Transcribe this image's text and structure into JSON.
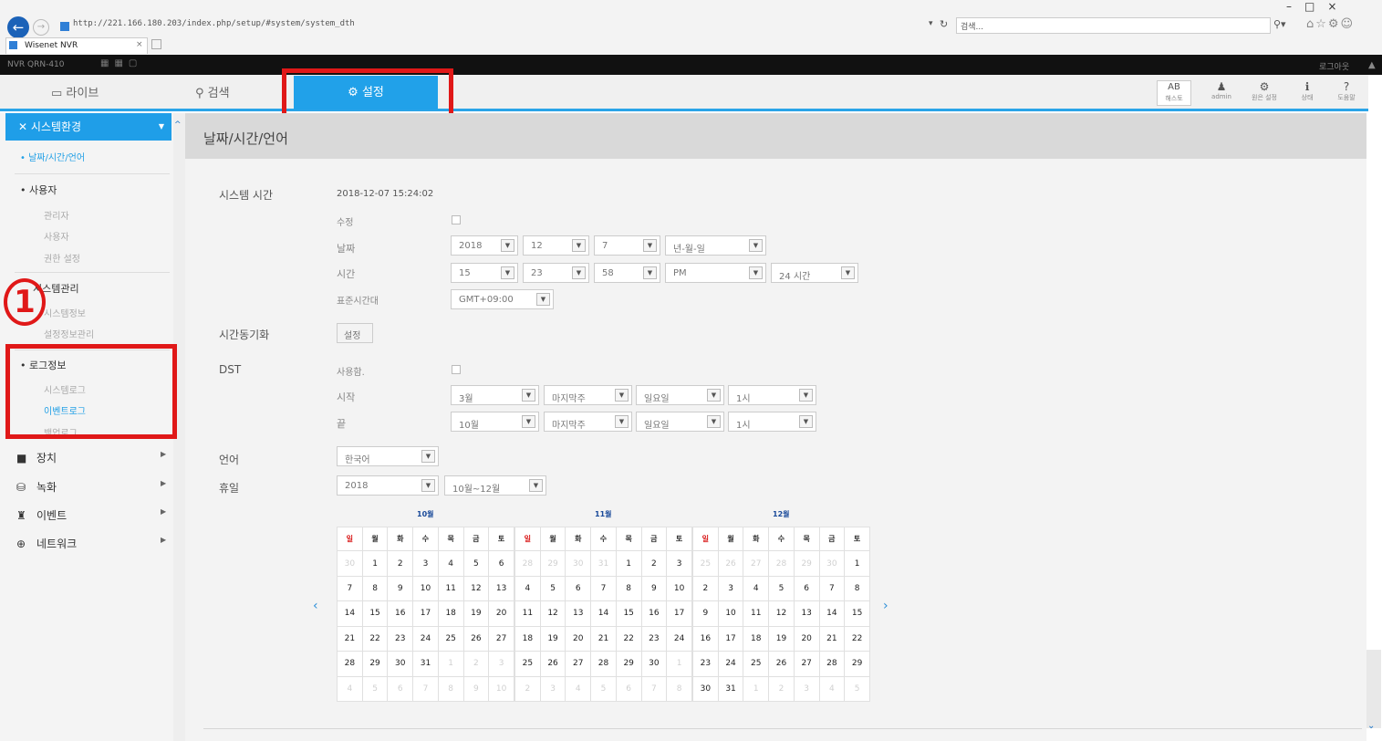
{
  "browser": {
    "address": "http://221.166.180.203/index.php/setup/#system/system_dth",
    "search_placeholder": "검색...",
    "tab_title": "Wisenet NVR",
    "tab_close": "×"
  },
  "topbar": {
    "model": "NVR QRN-410",
    "logout": "로그아웃"
  },
  "nav": {
    "live": "라이브",
    "search": "검색",
    "setup": "설정"
  },
  "toolbar": [
    {
      "name": "ab",
      "glyph": "AB",
      "label": "해스토"
    },
    {
      "name": "admin",
      "glyph": "👤",
      "label": "admin"
    },
    {
      "name": "shutdown",
      "glyph": "⚙",
      "label": "원은 설정"
    },
    {
      "name": "info",
      "glyph": "ℹ",
      "label": "상태"
    },
    {
      "name": "help",
      "glyph": "?",
      "label": "도움말"
    }
  ],
  "sidebar": {
    "header": "시스템환경",
    "sel_item": "날짜/시간/언어",
    "user": "사용자",
    "admin": "관리자",
    "user_sub": "사용자",
    "perm": "권한 설정",
    "sysmgmt": "시스템관리",
    "sysinfo": "시스템정보",
    "cfgmgmt": "설정정보관리",
    "log": "로그정보",
    "syslog": "시스템로그",
    "eventlog": "이벤트로그",
    "backuplog": "백업로그",
    "device": "장치",
    "record": "녹화",
    "event": "이벤트",
    "network": "네트워크",
    "circle": "1"
  },
  "content": {
    "title": "날짜/시간/언어",
    "systime_label": "시스템 시간",
    "systime_value": "2018-12-07 15:24:02",
    "edit_label": "수정",
    "date_label": "날짜",
    "date_year": "2018",
    "date_month": "12",
    "date_day": "7",
    "date_format": "년-월-일",
    "time_label": "시간",
    "time_hour": "15",
    "time_min": "23",
    "time_sec": "58",
    "time_ampm": "PM",
    "time_format": "24 시간",
    "tz_label": "표준시간대",
    "tz_value": "GMT+09:00",
    "sync_label": "시간동기화",
    "sync_btn": "설정",
    "dst_label": "DST",
    "dst_use": "사용함.",
    "dst_start_label": "시작",
    "dst_start": [
      "3월",
      "마지막주",
      "일요일",
      "1시"
    ],
    "dst_end_label": "끝",
    "dst_end": [
      "10월",
      "마지막주",
      "일요일",
      "1시"
    ],
    "lang_label": "언어",
    "lang_value": "한국어",
    "holiday_label": "휴일",
    "holiday_year": "2018",
    "holiday_range": "10월~12월"
  },
  "calendar": {
    "weekdays": [
      "일",
      "월",
      "화",
      "수",
      "목",
      "금",
      "토"
    ],
    "months": [
      {
        "title": "10월",
        "rows": [
          [
            "30",
            "1",
            "2",
            "3",
            "4",
            "5",
            "6"
          ],
          [
            "7",
            "8",
            "9",
            "10",
            "11",
            "12",
            "13"
          ],
          [
            "14",
            "15",
            "16",
            "17",
            "18",
            "19",
            "20"
          ],
          [
            "21",
            "22",
            "23",
            "24",
            "25",
            "26",
            "27"
          ],
          [
            "28",
            "29",
            "30",
            "31",
            "1",
            "2",
            "3"
          ],
          [
            "4",
            "5",
            "6",
            "7",
            "8",
            "9",
            "10"
          ]
        ],
        "other": [
          [
            1,
            0,
            0,
            0,
            0,
            0,
            0
          ],
          [
            0,
            0,
            0,
            0,
            0,
            0,
            0
          ],
          [
            0,
            0,
            0,
            0,
            0,
            0,
            0
          ],
          [
            0,
            0,
            0,
            0,
            0,
            0,
            0
          ],
          [
            0,
            0,
            0,
            0,
            1,
            1,
            1
          ],
          [
            1,
            1,
            1,
            1,
            1,
            1,
            1
          ]
        ]
      },
      {
        "title": "11월",
        "rows": [
          [
            "28",
            "29",
            "30",
            "31",
            "1",
            "2",
            "3"
          ],
          [
            "4",
            "5",
            "6",
            "7",
            "8",
            "9",
            "10"
          ],
          [
            "11",
            "12",
            "13",
            "14",
            "15",
            "16",
            "17"
          ],
          [
            "18",
            "19",
            "20",
            "21",
            "22",
            "23",
            "24"
          ],
          [
            "25",
            "26",
            "27",
            "28",
            "29",
            "30",
            "1"
          ],
          [
            "2",
            "3",
            "4",
            "5",
            "6",
            "7",
            "8"
          ]
        ],
        "other": [
          [
            1,
            1,
            1,
            1,
            0,
            0,
            0
          ],
          [
            0,
            0,
            0,
            0,
            0,
            0,
            0
          ],
          [
            0,
            0,
            0,
            0,
            0,
            0,
            0
          ],
          [
            0,
            0,
            0,
            0,
            0,
            0,
            0
          ],
          [
            0,
            0,
            0,
            0,
            0,
            0,
            1
          ],
          [
            1,
            1,
            1,
            1,
            1,
            1,
            1
          ]
        ]
      },
      {
        "title": "12월",
        "rows": [
          [
            "25",
            "26",
            "27",
            "28",
            "29",
            "30",
            "1"
          ],
          [
            "2",
            "3",
            "4",
            "5",
            "6",
            "7",
            "8"
          ],
          [
            "9",
            "10",
            "11",
            "12",
            "13",
            "14",
            "15"
          ],
          [
            "16",
            "17",
            "18",
            "19",
            "20",
            "21",
            "22"
          ],
          [
            "23",
            "24",
            "25",
            "26",
            "27",
            "28",
            "29"
          ],
          [
            "30",
            "31",
            "1",
            "2",
            "3",
            "4",
            "5"
          ]
        ],
        "other": [
          [
            1,
            1,
            1,
            1,
            1,
            1,
            0
          ],
          [
            0,
            0,
            0,
            0,
            0,
            0,
            0
          ],
          [
            0,
            0,
            0,
            0,
            0,
            0,
            0
          ],
          [
            0,
            0,
            0,
            0,
            0,
            0,
            0
          ],
          [
            0,
            0,
            0,
            0,
            0,
            0,
            0
          ],
          [
            0,
            0,
            1,
            1,
            1,
            1,
            1
          ]
        ]
      }
    ]
  }
}
